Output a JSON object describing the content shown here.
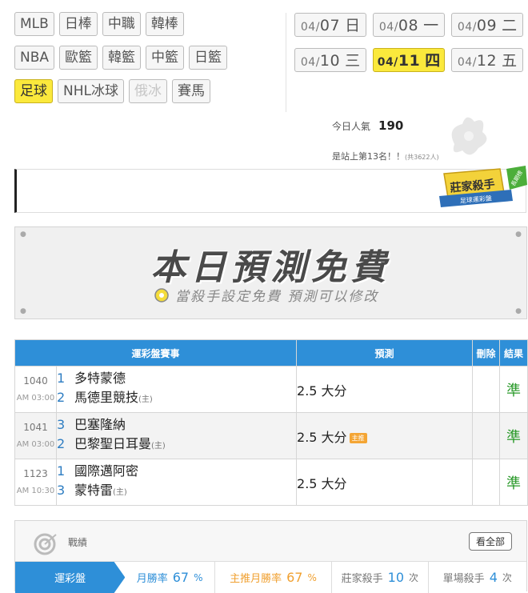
{
  "sports_tabs": [
    {
      "label": "MLB"
    },
    {
      "label": "日棒"
    },
    {
      "label": "中職"
    },
    {
      "label": "韓棒"
    },
    {
      "label": "NBA"
    },
    {
      "label": "歐籃"
    },
    {
      "label": "韓籃"
    },
    {
      "label": "中籃"
    },
    {
      "label": "日籃"
    },
    {
      "label": "足球",
      "active": true
    },
    {
      "label": "NHL冰球"
    },
    {
      "label": "俄冰",
      "disabled": true
    },
    {
      "label": "賽馬"
    }
  ],
  "dates": [
    {
      "md": "04/07",
      "wd": "日"
    },
    {
      "md": "04/08",
      "wd": "一"
    },
    {
      "md": "04/09",
      "wd": "二"
    },
    {
      "md": "04/10",
      "wd": "三"
    },
    {
      "md": "04/11",
      "wd": "四",
      "active": true
    },
    {
      "md": "04/12",
      "wd": "五"
    }
  ],
  "popularity": {
    "label": "今日人氣",
    "value": "190",
    "rank_text": "是站上第13名！！",
    "rank_total": "(共3622人)"
  },
  "badge": {
    "line1": "莊家殺手",
    "line2": "足球運彩盤",
    "ribbon": "長期榜"
  },
  "banner": {
    "title": "本日預測免費",
    "subtitle": "當殺手設定免費 預測可以修改"
  },
  "table": {
    "headers": {
      "match": "運彩盤賽事",
      "prediction": "預測",
      "delete": "刪除",
      "result": "結果"
    },
    "rows": [
      {
        "no": "1040",
        "time": "AM 03:00",
        "t1_num": "1",
        "t1": "多特蒙德",
        "t2_num": "2",
        "t2": "馬德里競技",
        "home_mark": "(主)",
        "prediction": "2.5 大分",
        "hot": "",
        "result": "準"
      },
      {
        "no": "1041",
        "time": "AM 03:00",
        "t1_num": "3",
        "t1": "巴塞隆納",
        "t2_num": "2",
        "t2": "巴黎聖日耳曼",
        "home_mark": "(主)",
        "prediction": "2.5 大分",
        "hot": "主推",
        "result": "準"
      },
      {
        "no": "1123",
        "time": "AM 10:30",
        "t1_num": "1",
        "t1": "國際邁阿密",
        "t2_num": "3",
        "t2": "蒙特雷",
        "home_mark": "(主)",
        "prediction": "2.5 大分",
        "hot": "",
        "result": "準"
      }
    ]
  },
  "record": {
    "title": "戰績",
    "view_all": "看全部",
    "tab": "運彩盤",
    "stats": [
      {
        "label": "月勝率",
        "value": "67",
        "unit": "%",
        "color": "#2e8fd8"
      },
      {
        "label": "主推月勝率",
        "value": "67",
        "unit": "%",
        "color": "#f0a030"
      },
      {
        "label": "莊家殺手",
        "value": "10",
        "unit": "次",
        "color": "#777777"
      },
      {
        "label": "單場殺手",
        "value": "4",
        "unit": "次",
        "color": "#777777"
      }
    ]
  },
  "colors": {
    "accent": "#2e8fd8",
    "active_yellow": "#fbe93c",
    "result_green": "#2a9a2a"
  }
}
